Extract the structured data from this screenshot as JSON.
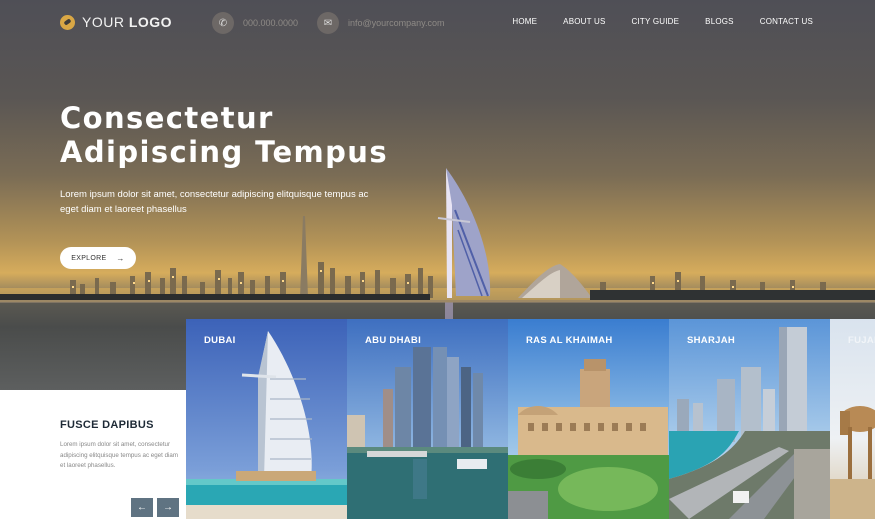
{
  "header": {
    "logo": {
      "light": "YOUR ",
      "bold": "LOGO",
      "icon": "compass-icon"
    },
    "phone": {
      "icon": "phone-icon",
      "text": "000.000.0000"
    },
    "email": {
      "icon": "mail-icon",
      "text": "info@yourcompany.com"
    },
    "nav": [
      {
        "label": "HOME"
      },
      {
        "label": "ABOUT US"
      },
      {
        "label": "CITY GUIDE"
      },
      {
        "label": "BLOGS"
      },
      {
        "label": "CONTACT US"
      }
    ]
  },
  "hero": {
    "title_line1": "Consectetur",
    "title_line2": "Adipiscing Tempus",
    "subtitle": "Lorem ipsum dolor sit amet, consectetur adipiscing elitquisque tempus ac eget diam et laoreet phasellus",
    "cta_label": "EXPLORE",
    "cta_icon": "arrow-right-icon"
  },
  "feature": {
    "title": "FUSCE DAPIBUS",
    "text": "Lorem ipsum dolor sit amet, consectetur adipiscing elitquisque tempus ac eget diam et laoreet phasellus.",
    "prev_icon": "arrow-left-icon",
    "next_icon": "arrow-right-icon"
  },
  "cities": [
    {
      "name": "DUBAI"
    },
    {
      "name": "ABU DHABI"
    },
    {
      "name": "RAS AL KHAIMAH"
    },
    {
      "name": "SHARJAH"
    },
    {
      "name": "FUJAIRAH"
    }
  ],
  "colors": {
    "accent": "#d9a745",
    "panel_title": "#1e2a36",
    "slider_button": "#5f7382"
  }
}
